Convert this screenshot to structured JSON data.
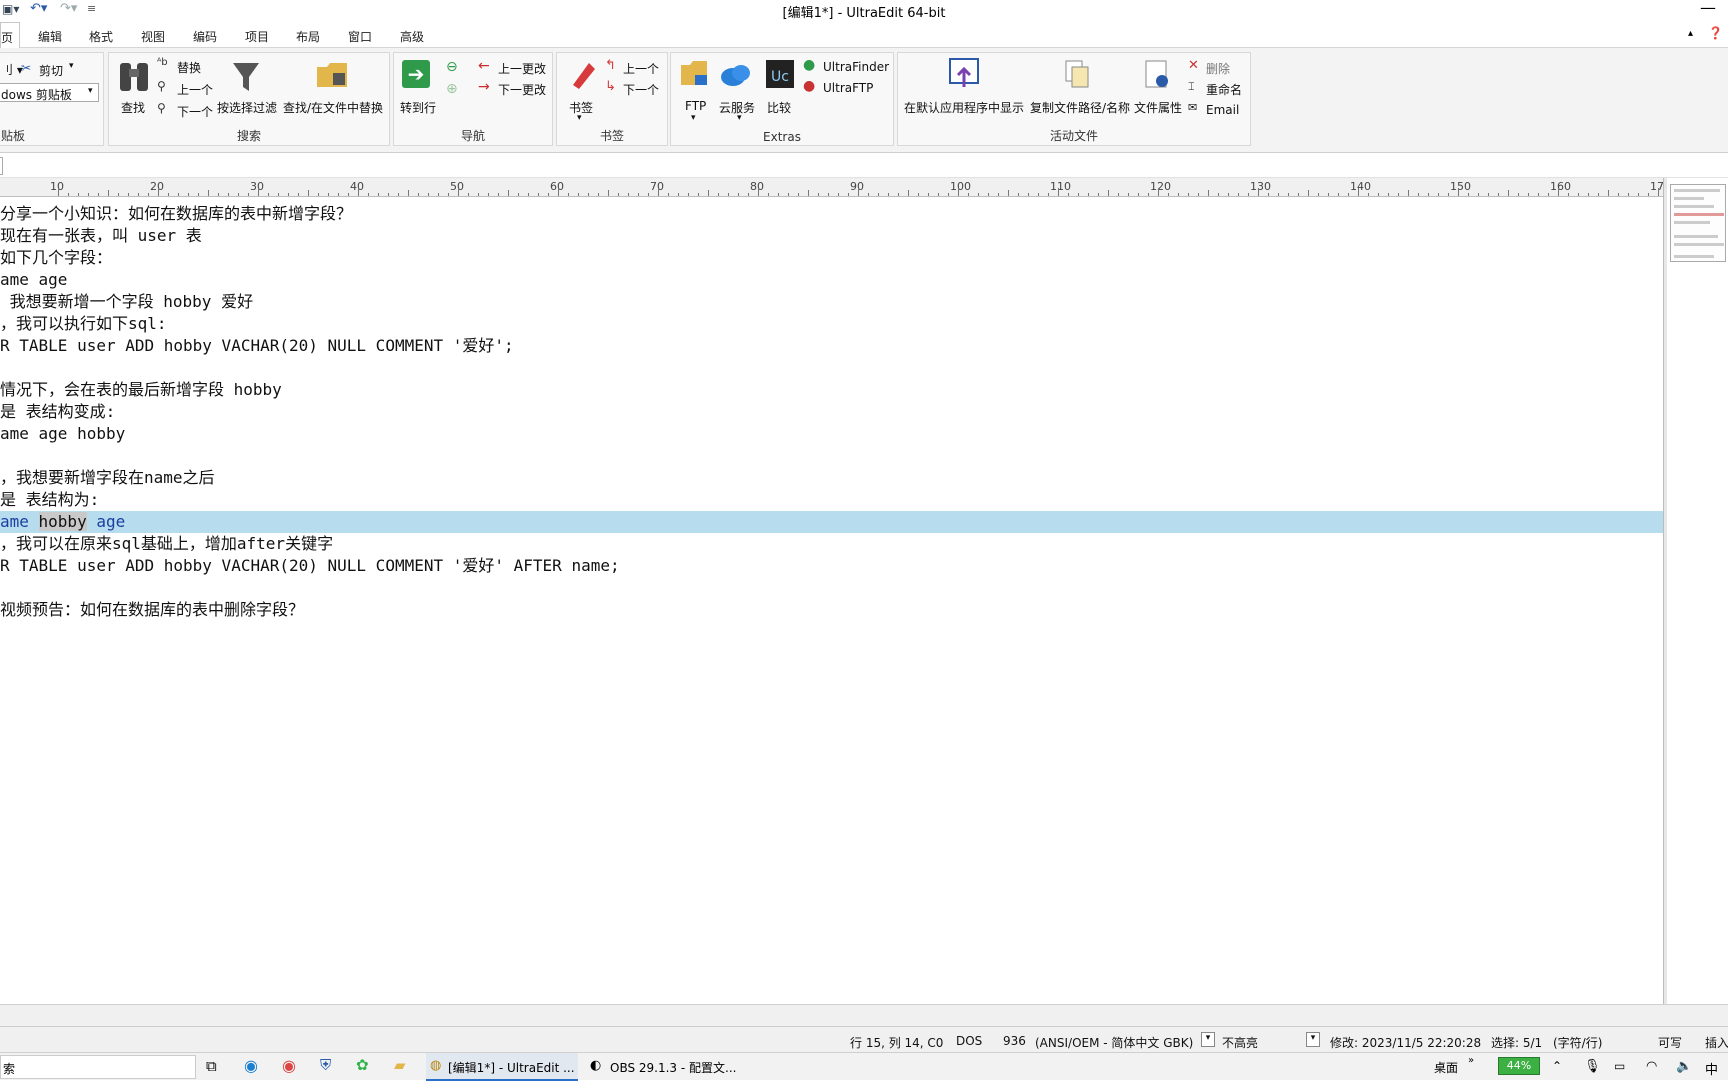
{
  "window": {
    "title": "[编辑1*] - UltraEdit 64-bit"
  },
  "menu": {
    "items": [
      "页",
      "编辑",
      "格式",
      "视图",
      "编码",
      "项目",
      "布局",
      "窗口",
      "高级"
    ]
  },
  "ribbon": {
    "clipboard": {
      "cut": "剪切",
      "combo_value": "dows 剪贴板",
      "label": "贴板"
    },
    "search": {
      "find": "查找",
      "replace": "替换",
      "prev": "上一个",
      "next": "下一个",
      "filter": "按选择过滤",
      "find_in_files": "查找/在文件中替换",
      "label": "搜索"
    },
    "nav": {
      "goto": "转到行",
      "prev_change": "上一更改",
      "next_change": "下一更改",
      "label": "导航"
    },
    "bookmarks": {
      "bookmark": "书签",
      "prev": "上一个",
      "next": "下一个",
      "label": "书签"
    },
    "extras": {
      "ftp": "FTP",
      "cloud": "云服务",
      "compare": "比较",
      "ultrafinder": "UltraFinder",
      "ultraftp": "UltraFTP",
      "label": "Extras"
    },
    "active_file": {
      "show_default": "在默认应用程序中显示",
      "copy_path": "复制文件路径/名称",
      "properties": "文件属性",
      "delete": "删除",
      "rename": "重命名",
      "email": "Email",
      "label": "活动文件"
    }
  },
  "ruler": {
    "labels": [
      "10",
      "20",
      "30",
      "40",
      "50",
      "60",
      "70",
      "80",
      "90",
      "100",
      "110",
      "120",
      "130",
      "140",
      "150",
      "160",
      "17"
    ]
  },
  "editor": {
    "lines": [
      "分享一个小知识：如何在数据库的表中新增字段？",
      "现在有一张表，叫 user 表",
      "如下几个字段：",
      "ame age",
      " 我想要新增一个字段 hobby 爱好",
      "，我可以执行如下sql:",
      "R TABLE user ADD hobby VACHAR(20) NULL COMMENT '爱好';",
      "",
      "情况下，会在表的最后新增字段 hobby",
      "是 表结构变成:",
      "ame age hobby",
      "",
      "，我想要新增字段在name之后",
      "是 表结构为:",
      "",
      "，我可以在原来sql基础上，增加after关键字",
      "R TABLE user ADD hobby VACHAR(20) NULL COMMENT '爱好' AFTER name;",
      "",
      "视频预告：如何在数据库的表中删除字段？"
    ],
    "highlight_line": {
      "part1": "ame ",
      "selected": "hobby",
      "part2": " age"
    }
  },
  "status": {
    "position": "行 15, 列 14, C0",
    "line_ending": "DOS",
    "codepage": "936",
    "encoding": "(ANSI/OEM - 简体中文 GBK)",
    "highlight": "不高亮",
    "modified": "修改:   2023/11/5 22:20:28",
    "selection": "选择: 5/1",
    "selection_unit": "(字符/行)",
    "writable": "可写",
    "insert": "插入"
  },
  "taskbar": {
    "search": "索",
    "ultraedit_task": "[编辑1*] - UltraEdit ...",
    "obs_task": "OBS 29.1.3 - 配置文...",
    "desktop": "桌面",
    "battery": "44%",
    "ime": "中"
  }
}
